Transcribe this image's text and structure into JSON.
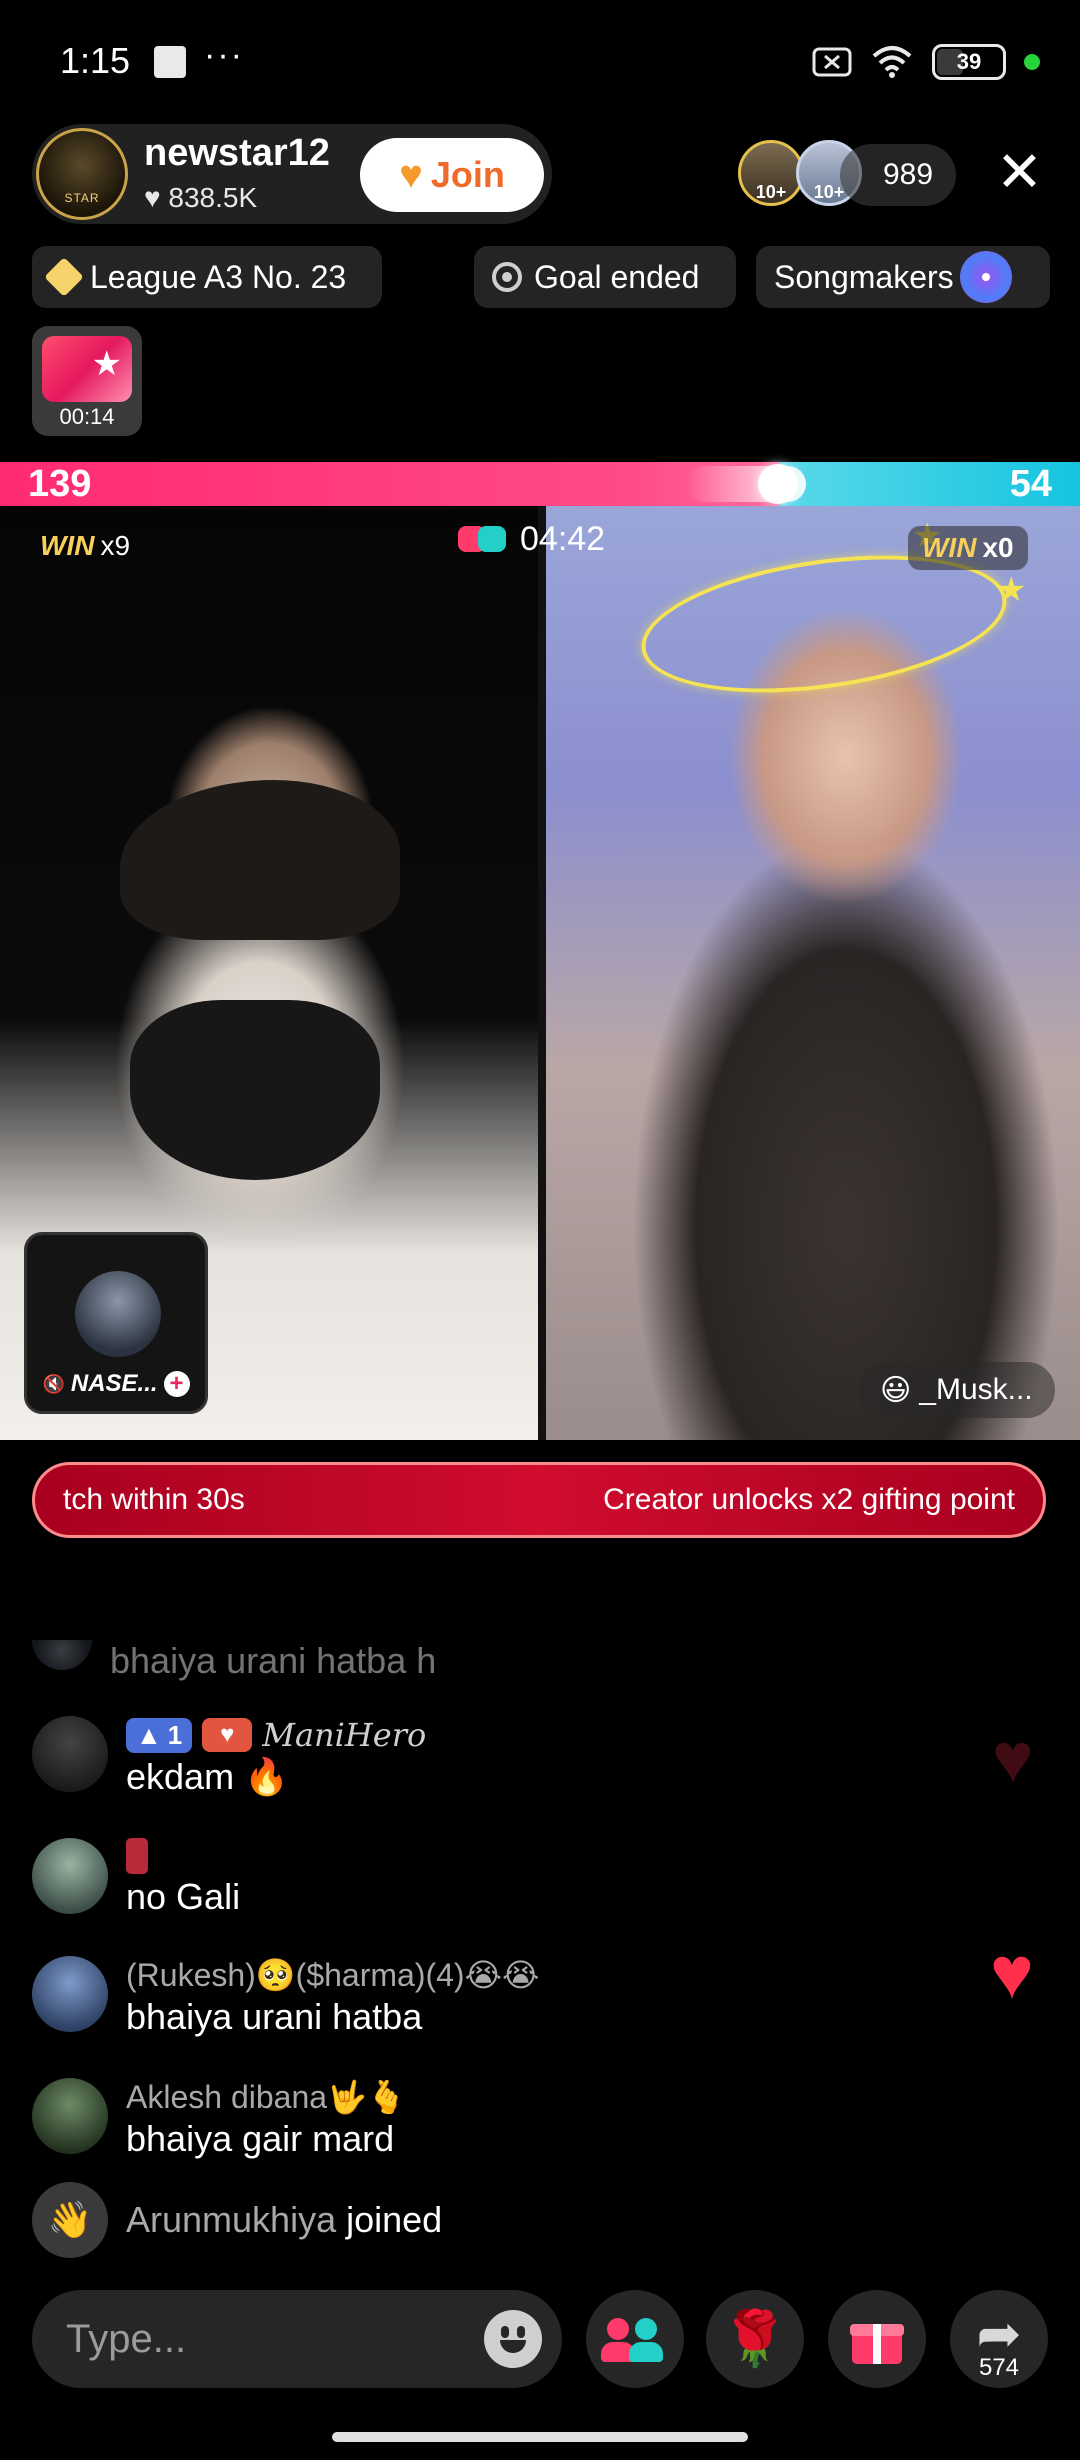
{
  "status_bar": {
    "time": "1:15",
    "more": "···",
    "battery": "39"
  },
  "host": {
    "name": "newstar12",
    "likes": "♥ 838.5K",
    "avatar_label": "STAR",
    "join_label": "Join",
    "viewer_badges": [
      "10+",
      "10+"
    ],
    "viewer_count": "989",
    "close": "✕"
  },
  "chips": {
    "league": "League A3 No. 23",
    "goal": "Goal ended",
    "songmakers": "Songmakers"
  },
  "gift_timer": "00:14",
  "battle": {
    "score_left": "139",
    "score_right": "54",
    "timer": "04:42",
    "win_left_label": "WIN",
    "win_left_count": "x9",
    "win_right_label": "WIN",
    "win_right_count": "x0",
    "guest_name": "NASE...",
    "opponent_name": "_Musk...",
    "opponent_emoji": "😃"
  },
  "banner": {
    "left_text": "tch within 30s",
    "right_text": "Creator unlocks x2 gifting point"
  },
  "comments": [
    {
      "name": "",
      "text": "bhaiya urani hatba h"
    },
    {
      "rank": "1",
      "name": "ManiHero",
      "text": "ekdam 🔥"
    },
    {
      "name": "",
      "text": "no Gali"
    },
    {
      "name": "(Rukesh)🥺($harma)(4)😭😭",
      "text": "bhaiya urani hatba"
    },
    {
      "name": "Aklesh dibana🤟🫰",
      "text": "bhaiya gair mard"
    }
  ],
  "join_event": {
    "user": "Arunmukhiya",
    "action": "joined"
  },
  "bottom_bar": {
    "placeholder": "Type...",
    "share_count": "574"
  },
  "colors": {
    "pink": "#ff2b71",
    "cyan": "#16c4e0",
    "banner_red": "#d00c2f",
    "join_orange": "#f06a2a"
  }
}
